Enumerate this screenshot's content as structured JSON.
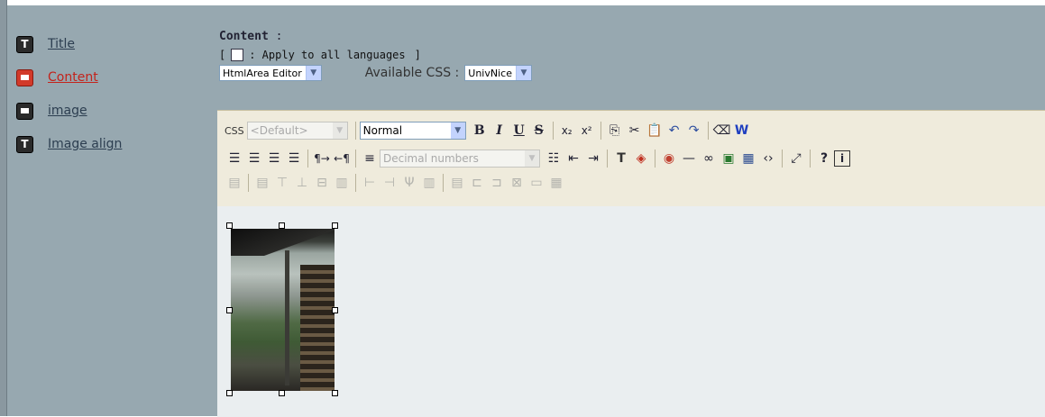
{
  "sidebar": {
    "items": [
      {
        "label": "Title",
        "icon": "text-field-icon",
        "active": false
      },
      {
        "label": "Content",
        "icon": "rich-text-icon",
        "active": true
      },
      {
        "label": "image",
        "icon": "image-field-icon",
        "active": false
      },
      {
        "label": "Image align",
        "icon": "text-field-icon",
        "active": false
      }
    ]
  },
  "content": {
    "title": "Content",
    "colon": " :",
    "apply_open": "[",
    "apply_label": ": Apply to all languages",
    "apply_close": "]",
    "editor_select": "HtmlArea Editor",
    "css_label": "Available CSS :",
    "css_select": "UnivNice"
  },
  "toolbar": {
    "css_label": "CSS",
    "css_select": "<Default>",
    "format_select": "Normal",
    "list_select": "Decimal numbers"
  },
  "colors": {
    "panel": "#97a8b0",
    "toolbar": "#efebdc",
    "active_link": "#c3231b",
    "link": "#2c3e50"
  }
}
